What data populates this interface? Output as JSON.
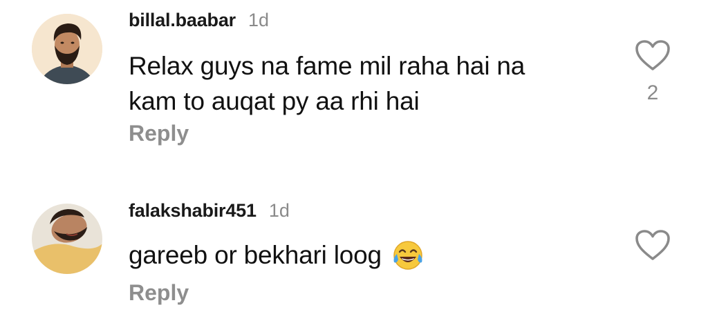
{
  "comments": [
    {
      "username": "billal.baabar",
      "time": "1d",
      "text_line1": "Relax guys na fame mil raha hai na",
      "text_line2": "kam to auqat py aa rhi hai",
      "reply_label": "Reply",
      "like_count": "2",
      "like_icon": "heart-outline"
    },
    {
      "username": "falakshabir451",
      "time": "1d",
      "text": "gareeb or bekhari loog",
      "emoji": "face-with-tears-of-joy",
      "reply_label": "Reply",
      "like_icon": "heart-outline"
    }
  ],
  "colors": {
    "text": "#111111",
    "secondary": "#8a8a8a",
    "reply": "#8e8e8e",
    "background": "#ffffff"
  }
}
